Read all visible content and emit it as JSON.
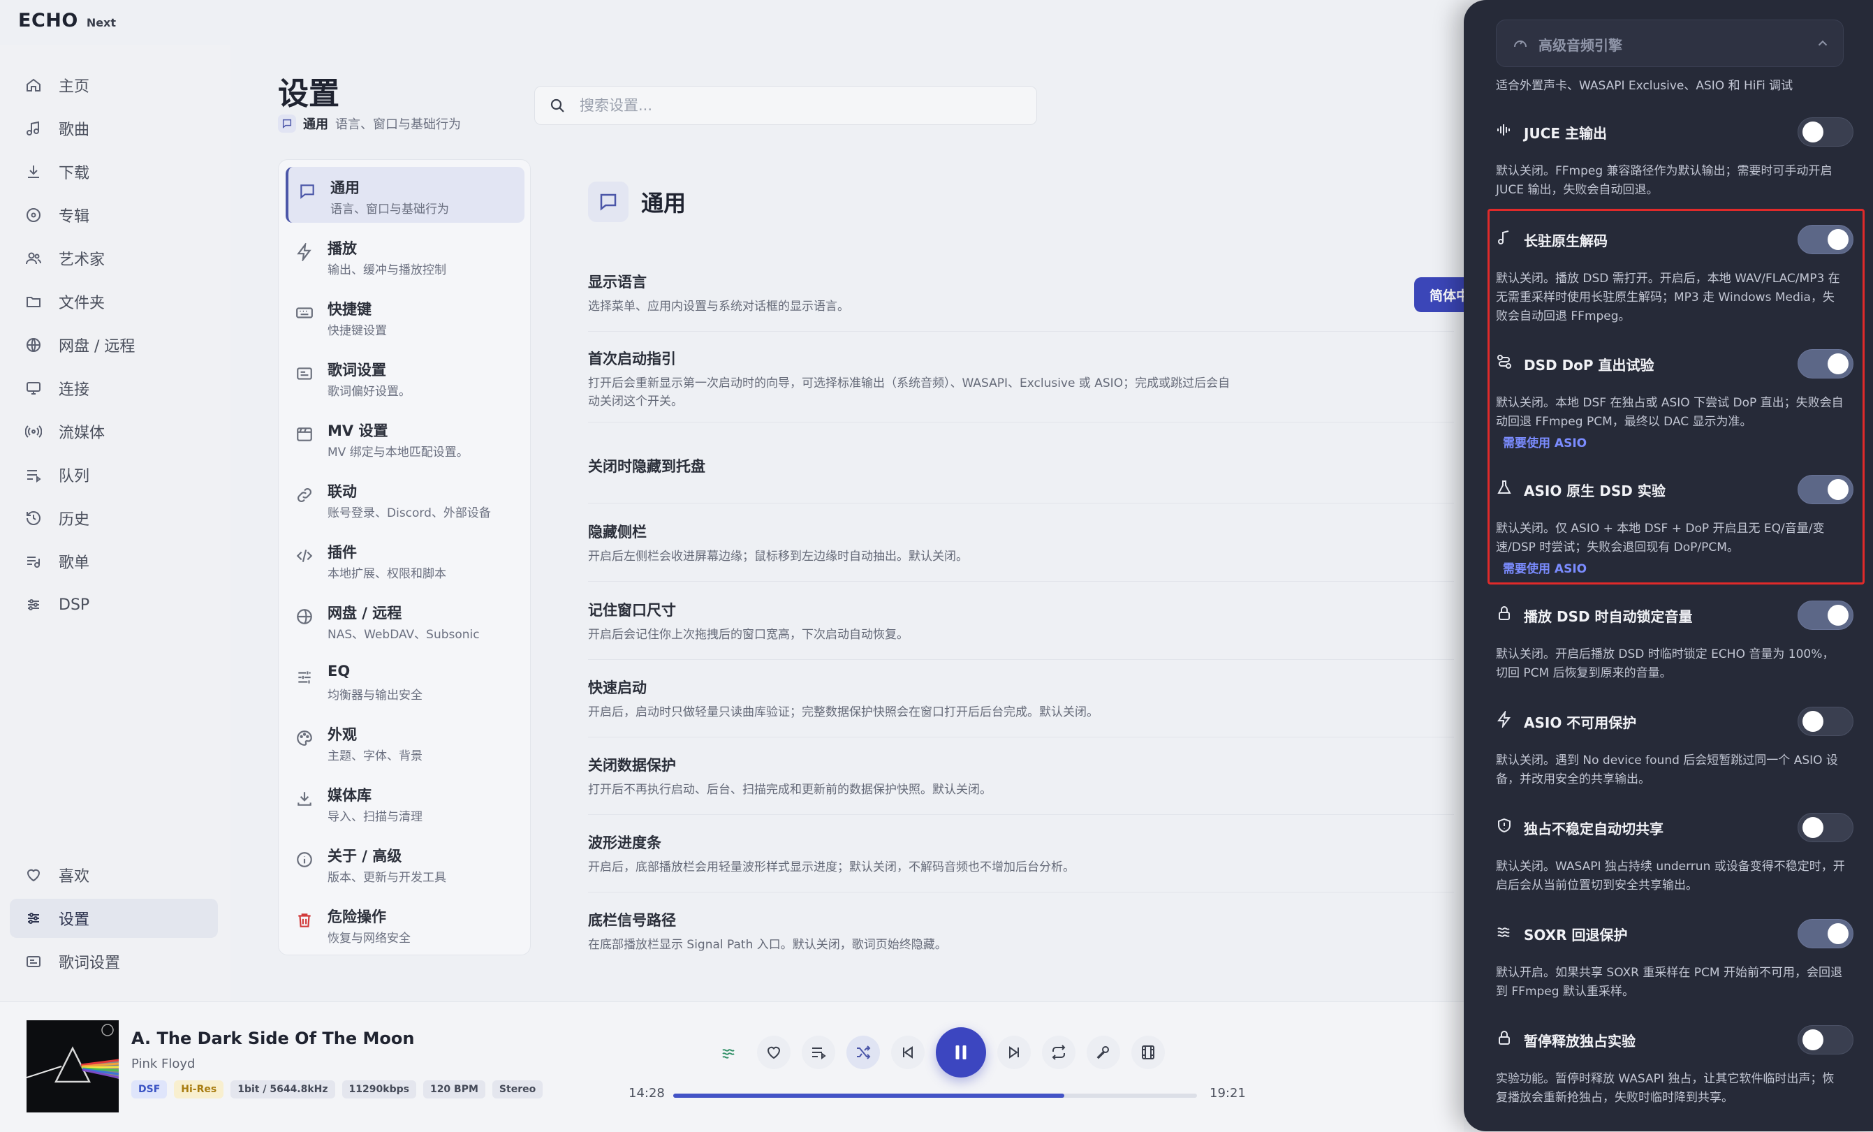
{
  "app": {
    "logo": "ECHO",
    "logo_sub": "Next"
  },
  "leftnav": {
    "items": [
      {
        "label": "主页",
        "icon": "home-icon"
      },
      {
        "label": "歌曲",
        "icon": "music-note-icon"
      },
      {
        "label": "下载",
        "icon": "download-icon"
      },
      {
        "label": "专辑",
        "icon": "album-icon"
      },
      {
        "label": "艺术家",
        "icon": "artists-icon"
      },
      {
        "label": "文件夹",
        "icon": "folder-icon"
      },
      {
        "label": "网盘 / 远程",
        "icon": "globe-icon"
      },
      {
        "label": "连接",
        "icon": "monitor-icon"
      },
      {
        "label": "流媒体",
        "icon": "broadcast-icon"
      },
      {
        "label": "队列",
        "icon": "queue-icon"
      },
      {
        "label": "历史",
        "icon": "history-icon"
      },
      {
        "label": "歌单",
        "icon": "playlist-icon"
      },
      {
        "label": "DSP",
        "icon": "sliders-icon"
      }
    ],
    "bottom": [
      {
        "label": "喜欢",
        "icon": "heart-icon"
      },
      {
        "label": "设置",
        "icon": "settings-sliders-icon",
        "active": true
      },
      {
        "label": "歌词设置",
        "icon": "lyrics-icon"
      }
    ]
  },
  "settings": {
    "title": "设置",
    "crumb_title": "通用",
    "crumb_desc": "语言、窗口与基础行为",
    "search_placeholder": "搜索设置..."
  },
  "categories": [
    {
      "title": "通用",
      "desc": "语言、窗口与基础行为",
      "icon": "chat-icon",
      "active": true
    },
    {
      "title": "播放",
      "desc": "输出、缓冲与播放控制",
      "icon": "bolt-icon"
    },
    {
      "title": "快捷键",
      "desc": "快捷键设置",
      "icon": "keyboard-icon"
    },
    {
      "title": "歌词设置",
      "desc": "歌词偏好设置。",
      "icon": "lyrics-icon"
    },
    {
      "title": "MV 设置",
      "desc": "MV 绑定与本地匹配设置。",
      "icon": "film-icon"
    },
    {
      "title": "联动",
      "desc": "账号登录、Discord、外部设备",
      "icon": "link-icon"
    },
    {
      "title": "插件",
      "desc": "本地扩展、权限和脚本",
      "icon": "code-icon"
    },
    {
      "title": "网盘 / 远程",
      "desc": "NAS、WebDAV、Subsonic",
      "icon": "cloud-globe-icon"
    },
    {
      "title": "EQ",
      "desc": "均衡器与输出安全",
      "icon": "eq-icon"
    },
    {
      "title": "外观",
      "desc": "主题、字体、背景",
      "icon": "palette-icon"
    },
    {
      "title": "媒体库",
      "desc": "导入、扫描与清理",
      "icon": "library-import-icon"
    },
    {
      "title": "关于 / 高级",
      "desc": "版本、更新与开发工具",
      "icon": "info-icon"
    },
    {
      "title": "危险操作",
      "desc": "恢复与网络安全",
      "icon": "trash-icon",
      "danger": true
    }
  ],
  "section": {
    "title": "通用",
    "lang_button": "简体中文"
  },
  "rows": [
    {
      "title": "显示语言",
      "desc": "选择菜单、应用内设置与系统对话框的显示语言。"
    },
    {
      "title": "首次启动指引",
      "desc": "打开后会重新显示第一次启动时的向导，可选择标准输出（系统音频）、WASAPI、Exclusive 或 ASIO；完成或跳过后会自动关闭这个开关。"
    },
    {
      "title": "关闭时隐藏到托盘",
      "desc": ""
    },
    {
      "title": "隐藏侧栏",
      "desc": "开启后左侧栏会收进屏幕边缘；鼠标移到左边缘时自动抽出。默认关闭。"
    },
    {
      "title": "记住窗口尺寸",
      "desc": "开启后会记住你上次拖拽后的窗口宽高，下次启动自动恢复。"
    },
    {
      "title": "快速启动",
      "desc": "开启后，启动时只做轻量只读曲库验证；完整数据保护快照会在窗口打开后后台完成。默认关闭。"
    },
    {
      "title": "关闭数据保护",
      "desc": "打开后不再执行启动、后台、扫描完成和更新前的数据保护快照。默认关闭。"
    },
    {
      "title": "波形进度条",
      "desc": "开启后，底部播放栏会用轻量波形样式显示进度；默认关闭，不解码音频也不增加后台分析。"
    },
    {
      "title": "底栏信号路径",
      "desc": "在底部播放栏显示 Signal Path 入口。默认关闭，歌词页始终隐藏。"
    }
  ],
  "drawer": {
    "header": "高级音频引擎",
    "subtitle": "适合外置声卡、WASAPI Exclusive、ASIO 和 HiFi 调试",
    "options": [
      {
        "title": "JUCE 主输出",
        "icon": "waveform-icon",
        "on": false,
        "desc": "默认关闭。FFmpeg 兼容路径作为默认输出；需要时可手动开启 JUCE 输出，失败会自动回退。",
        "req": ""
      },
      {
        "title": "长驻原生解码",
        "icon": "music-note-icon",
        "on": true,
        "desc": "默认关闭。播放 DSD 需打开。开启后，本地 WAV/FLAC/MP3 在无需重采样时使用长驻原生解码；MP3 走 Windows Media，失败会自动回退 FFmpeg。",
        "req": ""
      },
      {
        "title": "DSD DoP 直出试验",
        "icon": "route-icon",
        "on": true,
        "desc": "默认关闭。本地 DSF 在独占或 ASIO 下尝试 DoP 直出；失败会自动回退 FFmpeg PCM，最终以 DAC 显示为准。",
        "req": "需要使用 ASIO"
      },
      {
        "title": "ASIO 原生 DSD 实验",
        "icon": "flask-icon",
        "on": true,
        "desc": "默认关闭。仅 ASIO + 本地 DSF + DoP 开启且无 EQ/音量/变速/DSP 时尝试；失败会退回现有 DoP/PCM。",
        "req": "需要使用 ASIO"
      },
      {
        "title": "播放 DSD 时自动锁定音量",
        "icon": "lock-icon",
        "on": true,
        "desc": "默认关闭。开启后播放 DSD 时临时锁定 ECHO 音量为 100%，切回 PCM 后恢复到原来的音量。",
        "req": ""
      },
      {
        "title": "ASIO 不可用保护",
        "icon": "bolt-icon",
        "on": false,
        "desc": "默认关闭。遇到 No device found 后会短暂跳过同一个 ASIO 设备，并改用安全的共享输出。",
        "req": ""
      },
      {
        "title": "独占不稳定自动切共享",
        "icon": "shield-icon",
        "on": false,
        "desc": "默认关闭。WASAPI 独占持续 underrun 或设备变得不稳定时，开启后会从当前位置切到安全共享输出。",
        "req": ""
      },
      {
        "title": "SOXR 回退保护",
        "icon": "waves-icon",
        "on": true,
        "desc": "默认开启。如果共享 SOXR 重采样在 PCM 开始前不可用，会回退到 FFmpeg 默认重采样。",
        "req": ""
      },
      {
        "title": "暂停释放独占实验",
        "icon": "lock-icon",
        "on": false,
        "desc": "实验功能。暂停时释放 WASAPI 独占，让其它软件临时出声；恢复播放会重新抢独占，失败时临时降到共享。",
        "req": ""
      }
    ]
  },
  "player": {
    "title": "A. The Dark Side Of The Moon",
    "artist": "Pink Floyd",
    "badges": [
      "DSF",
      "Hi-Res",
      "1bit / 5644.8kHz",
      "11290kbps",
      "120 BPM",
      "Stereo"
    ],
    "elapsed": "14:28",
    "total": "19:21",
    "progress": 0.747,
    "accent": "#3c46c0"
  }
}
